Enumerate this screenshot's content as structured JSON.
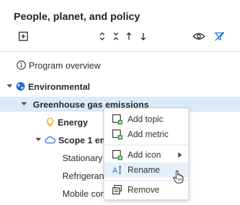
{
  "panel": {
    "title": "People, planet, and policy"
  },
  "toolbar": {
    "add_icon": "plus-square-icon",
    "expand_all_icon": "expand-vertical-icon",
    "collapse_all_icon": "collapse-vertical-icon",
    "move_up_icon": "arrow-up-icon",
    "move_down_icon": "arrow-down-icon",
    "view_icon": "eye-icon",
    "filter_icon": "filter-off-icon"
  },
  "tree": {
    "program_overview": "Program overview",
    "environmental": "Environmental",
    "greenhouse": "Greenhouse gas emissions",
    "energy": "Energy",
    "scope1": "Scope 1 emi",
    "stationary": "Stationary",
    "refrigerants": "Refrigerant",
    "mobile": "Mobile com"
  },
  "context_menu": {
    "add_topic": "Add topic",
    "add_metric": "Add metric",
    "add_icon": "Add icon",
    "rename": "Rename",
    "remove": "Remove"
  },
  "colors": {
    "selected_row": "#dbeaf8",
    "accent_blue": "#1f6fd1",
    "add_green": "#2e9e3a",
    "energy_orange": "#f39c12"
  }
}
